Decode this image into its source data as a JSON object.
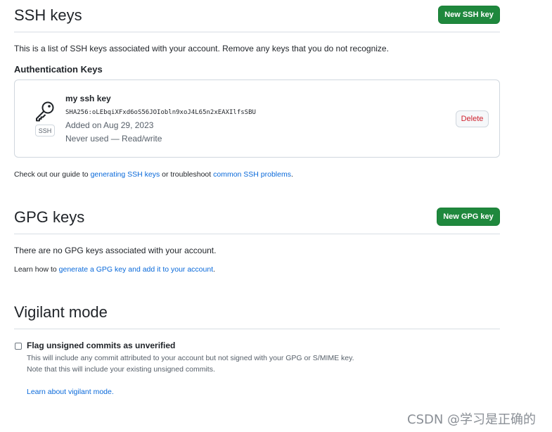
{
  "ssh": {
    "heading": "SSH keys",
    "new_button": "New SSH key",
    "description": "This is a list of SSH keys associated with your account. Remove any keys that you do not recognize.",
    "auth_heading": "Authentication Keys",
    "key": {
      "title": "my ssh key",
      "fingerprint": "SHA256:oLEbqiXFxd6oS56JOIobln9xoJ4L65n2xEAXIlfsSBU",
      "added": "Added on Aug 29, 2023",
      "usage": "Never used — Read/write",
      "badge": "SSH",
      "delete_label": "Delete",
      "icon": "key-icon"
    },
    "guide_prefix": "Check out our guide to ",
    "guide_link1": "generating SSH keys",
    "guide_middle": " or troubleshoot ",
    "guide_link2": "common SSH problems",
    "guide_suffix": "."
  },
  "gpg": {
    "heading": "GPG keys",
    "new_button": "New GPG key",
    "empty_text": "There are no GPG keys associated with your account.",
    "learn_prefix": "Learn how to ",
    "learn_link": "generate a GPG key and add it to your account",
    "learn_suffix": "."
  },
  "vigilant": {
    "heading": "Vigilant mode",
    "checkbox_label": "Flag unsigned commits as unverified",
    "checked": false,
    "note_line1": "This will include any commit attributed to your account but not signed with your GPG or S/MIME key.",
    "note_line2": "Note that this will include your existing unsigned commits.",
    "learn_link": "Learn about vigilant mode."
  },
  "watermark": "CSDN @学习是正确的",
  "colors": {
    "primary_button": "#1f883d",
    "link": "#0969da",
    "danger": "#cf222e",
    "border": "#d0d7de"
  }
}
